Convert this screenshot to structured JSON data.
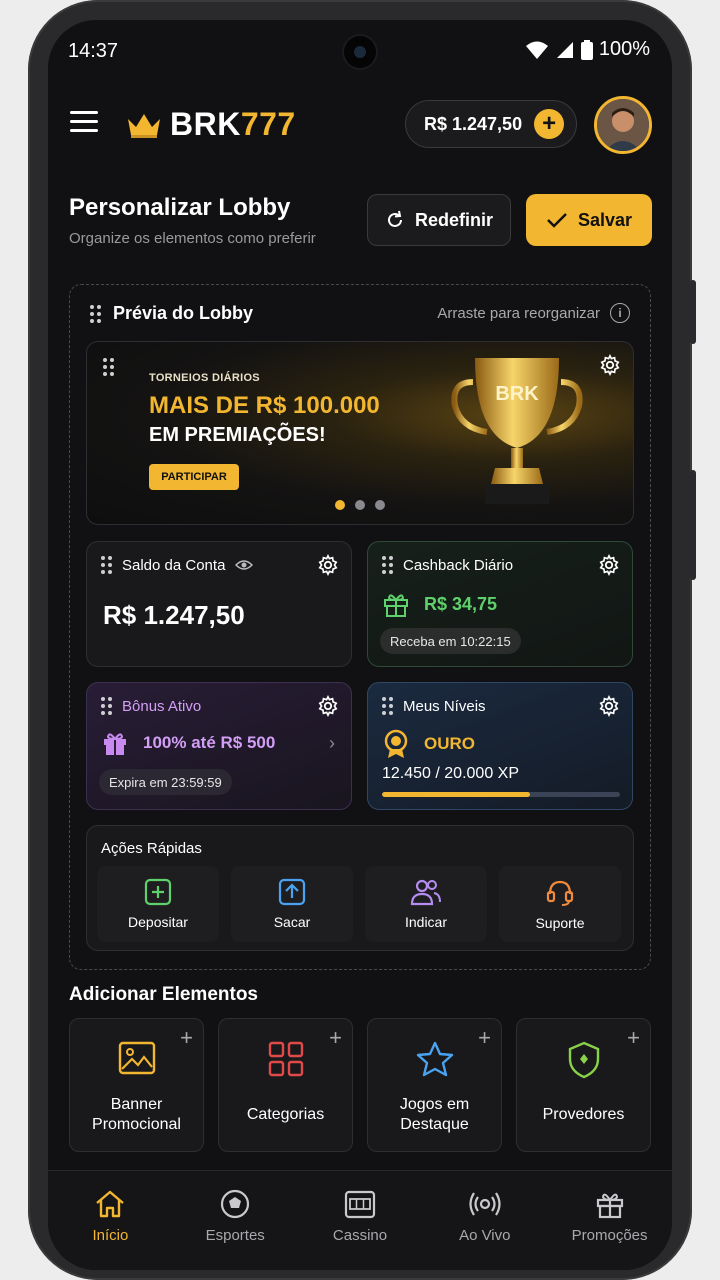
{
  "status": {
    "time": "14:37",
    "battery": "100%"
  },
  "header": {
    "logo_a": "BRK",
    "logo_b": "777",
    "balance": "R$ 1.247,50"
  },
  "page": {
    "title": "Personalizar Lobby",
    "subtitle": "Organize os elementos como preferir",
    "reset_label": "Redefinir",
    "save_label": "Salvar"
  },
  "preview": {
    "title": "Prévia do Lobby",
    "hint": "Arraste para reorganizar",
    "banner": {
      "kicker": "TORNEIOS DIÁRIOS",
      "line1": "MAIS DE R$ 100.000",
      "line2": "EM PREMIAÇÕES!",
      "button": "PARTICIPAR",
      "trophy_text": "BRK"
    },
    "balance_card": {
      "title": "Saldo da Conta",
      "amount": "R$ 1.247,50"
    },
    "cashback_card": {
      "title": "Cashback Diário",
      "amount": "R$ 34,75",
      "chip": "Receba em 10:22:15"
    },
    "bonus_card": {
      "title": "Bônus Ativo",
      "offer": "100% até R$ 500",
      "chip": "Expira em 23:59:59"
    },
    "levels_card": {
      "title": "Meus Níveis",
      "tier": "OURO",
      "xp": "12.450 / 20.000 XP",
      "progress": 0.6225
    },
    "quick_actions": {
      "title": "Ações Rápidas",
      "items": [
        {
          "label": "Depositar",
          "icon": "plus-square-icon",
          "color": "#5fd16c"
        },
        {
          "label": "Sacar",
          "icon": "upload-icon",
          "color": "#4aa3f0"
        },
        {
          "label": "Indicar",
          "icon": "users-icon",
          "color": "#b58cf0"
        },
        {
          "label": "Suporte",
          "icon": "headset-icon",
          "color": "#f08a3c"
        }
      ]
    }
  },
  "add_elements": {
    "title": "Adicionar Elementos",
    "items": [
      {
        "label_1": "Banner",
        "label_2": "Promocional",
        "icon": "image-icon",
        "color": "#f2b630"
      },
      {
        "label_1": "Categorias",
        "icon": "grid-icon",
        "color": "#e24a4a"
      },
      {
        "label_1": "Jogos em",
        "label_2": "Destaque",
        "icon": "star-icon",
        "color": "#4aa3f0"
      },
      {
        "label_1": "Provedores",
        "icon": "shield-icon",
        "color": "#8ad14a"
      }
    ]
  },
  "nav": {
    "items": [
      {
        "label": "Início",
        "icon": "home-icon"
      },
      {
        "label": "Esportes",
        "icon": "soccer-ball-icon"
      },
      {
        "label": "Cassino",
        "icon": "slot-machine-icon"
      },
      {
        "label": "Ao Vivo",
        "icon": "live-icon"
      },
      {
        "label": "Promoções",
        "icon": "gift-icon"
      }
    ],
    "active": "Início"
  },
  "colors": {
    "accent": "#f2b630",
    "background": "#111113",
    "green": "#5fd16c",
    "purple": "#d39ef5"
  }
}
